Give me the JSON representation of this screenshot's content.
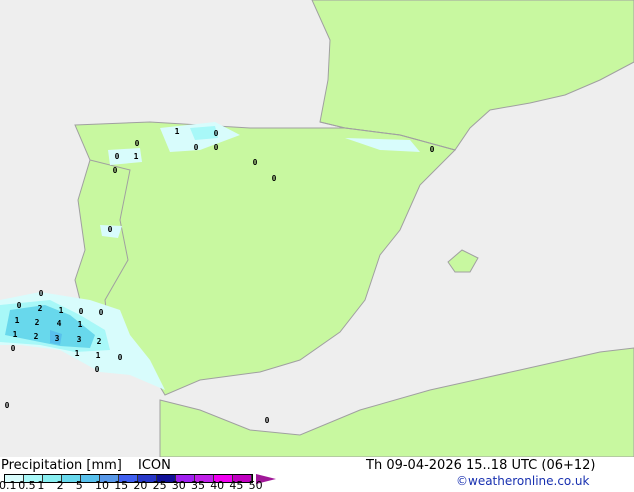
{
  "title": "Precipitation [mm]",
  "model": "ICON",
  "datetime": "Th 09-04-2026 15..18 UTC (06+12)",
  "credit": "©weatheronline.co.uk",
  "colors": {
    "sea": "#eeeeee",
    "land": "#c8f8a0",
    "border": "#a0a0a0"
  },
  "scale": {
    "ticks": [
      "0.1",
      "0.5",
      "1",
      "2",
      "5",
      "10",
      "15",
      "20",
      "25",
      "30",
      "35",
      "40",
      "45",
      "50"
    ],
    "colors": [
      "#d8fcfc",
      "#a8f8f8",
      "#88eef0",
      "#68d8ec",
      "#58c0ec",
      "#5898e8",
      "#4060f0",
      "#2838c8",
      "#101098",
      "#a020f0",
      "#c020e8",
      "#f000f0",
      "#c000c0"
    ]
  },
  "labels": [
    "1",
    "0",
    "0",
    "0",
    "0",
    "0",
    "1",
    "0",
    "0",
    "0",
    "0",
    "0",
    "0",
    "0",
    "2",
    "1",
    "0",
    "0",
    "1",
    "2",
    "4",
    "1",
    "1",
    "2",
    "3",
    "3",
    "2",
    "0",
    "1",
    "1",
    "0",
    "0",
    "0",
    "0"
  ]
}
